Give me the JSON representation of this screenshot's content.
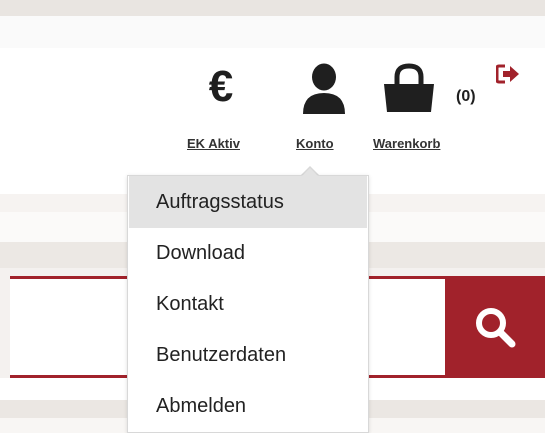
{
  "header": {
    "nav": [
      {
        "id": "ek",
        "label": "EK Aktiv",
        "icon": "euro-icon",
        "glyph": "€"
      },
      {
        "id": "account",
        "label": "Konto",
        "icon": "user-icon"
      },
      {
        "id": "cart",
        "label": "Warenkorb",
        "icon": "shopping-bag-icon",
        "count": "(0)"
      }
    ],
    "logout_icon": "logout-icon"
  },
  "account_menu": {
    "items": [
      {
        "label": "Auftragsstatus",
        "active": true
      },
      {
        "label": "Download",
        "active": false
      },
      {
        "label": "Kontakt",
        "active": false
      },
      {
        "label": "Benutzerdaten",
        "active": false
      },
      {
        "label": "Abmelden",
        "active": false
      }
    ]
  },
  "search": {
    "placeholder": "",
    "button_icon": "search-icon"
  },
  "colors": {
    "brand_red": "#a1222b",
    "text_dark": "#1f1f1f",
    "menu_active_bg": "#e3e3e3"
  }
}
